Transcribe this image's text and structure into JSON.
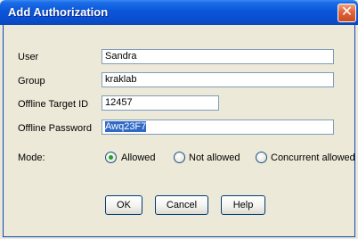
{
  "window": {
    "title": "Add Authorization",
    "close_glyph": "✕",
    "close_icon": "close-icon"
  },
  "form": {
    "user_label": "User",
    "user_value": "Sandra",
    "group_label": "Group",
    "group_value": "kraklab",
    "target_label": "Offline Target ID",
    "target_value": "12457",
    "password_label": "Offline Password",
    "password_value": "Awq23F7"
  },
  "mode": {
    "label": "Mode:",
    "options": [
      "Allowed",
      "Not allowed",
      "Concurrent allowed"
    ],
    "selected": "Allowed"
  },
  "buttons": {
    "ok": "OK",
    "cancel": "Cancel",
    "help": "Help"
  },
  "colors": {
    "titlebar": "#0a56d8",
    "selection": "#316ac5",
    "radio_dot": "#21a121",
    "dialog_bg": "#ece9d8"
  }
}
